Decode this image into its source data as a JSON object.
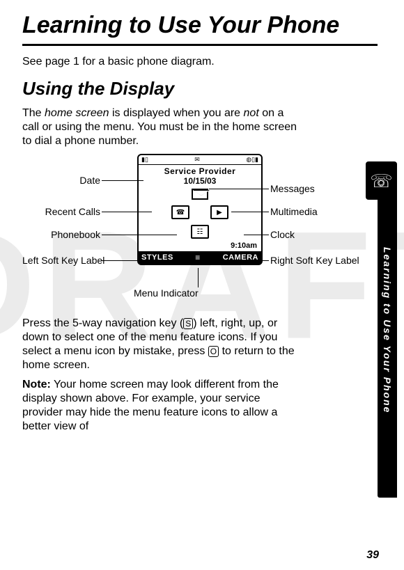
{
  "page_number": "39",
  "sidebar_text": "Learning to Use Your Phone",
  "title": "Learning to Use Your Phone",
  "intro": "See page 1 for a basic phone diagram.",
  "section_heading": "Using the Display",
  "para1_a": "The ",
  "para1_em1": "home screen",
  "para1_b": " is displayed when you are ",
  "para1_em2": "not",
  "para1_c": " on a call or using the menu. You must be in the home screen to dial a phone number.",
  "diagram": {
    "service_provider": "Service Provider",
    "date_value": "10/15/03",
    "time_value": "9:10am",
    "left_softkey": "STYLES",
    "right_softkey": "CAMERA",
    "menu_glyph": "≡"
  },
  "callouts": {
    "date": "Date",
    "recent_calls": "Recent Calls",
    "phonebook": "Phonebook",
    "left_soft": "Left Soft Key Label",
    "menu_indicator": "Menu Indicator",
    "messages": "Messages",
    "multimedia": "Multimedia",
    "clock": "Clock",
    "right_soft": "Right Soft Key Label"
  },
  "para2_a": "Press the 5-way navigation key (",
  "para2_nav": "S",
  "para2_b": ") left, right, up, or down to select one of the menu feature icons. If you select a menu icon by mistake, press ",
  "para2_end": "O",
  "para2_c": " to return to the home screen.",
  "note_label": "Note:",
  "note_text": " Your home screen may look different from the display shown above. For example, your service provider may hide the menu feature icons to allow a better view of",
  "watermark": "DRAFT"
}
